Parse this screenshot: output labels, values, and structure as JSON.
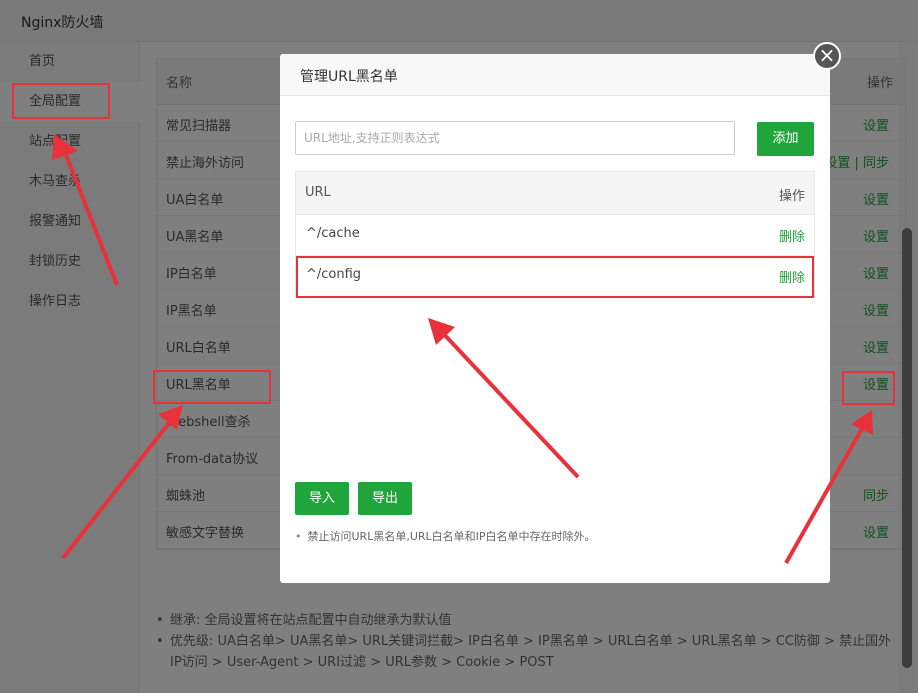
{
  "app_title": "Nginx防火墙",
  "sidebar": {
    "items": [
      {
        "label": "首页"
      },
      {
        "label": "全局配置"
      },
      {
        "label": "站点配置"
      },
      {
        "label": "木马查杀"
      },
      {
        "label": "报警通知"
      },
      {
        "label": "封锁历史"
      },
      {
        "label": "操作日志"
      }
    ]
  },
  "table": {
    "header_name": "名称",
    "header_op": "操作",
    "rows": [
      {
        "name": "常见扫描器",
        "op": "设置"
      },
      {
        "name": "禁止海外访问",
        "op": "设置 | 同步"
      },
      {
        "name": "UA白名单",
        "op": "设置"
      },
      {
        "name": "UA黑名单",
        "op": "设置"
      },
      {
        "name": "IP白名单",
        "op": "设置"
      },
      {
        "name": "IP黑名单",
        "op": "设置"
      },
      {
        "name": "URL白名单",
        "op": "设置"
      },
      {
        "name": "URL黑名单",
        "op": "设置"
      },
      {
        "name": "Webshell查杀",
        "op": ""
      },
      {
        "name": "From-data协议",
        "op": ""
      },
      {
        "name": "蜘蛛池",
        "op": "同步"
      },
      {
        "name": "敏感文字替换",
        "op": "设置"
      }
    ]
  },
  "notes": [
    "继承: 全局设置将在站点配置中自动继承为默认值",
    "优先级: UA白名单> UA黑名单> URL关键词拦截> IP白名单 > IP黑名单 > URL白名单 > URL黑名单 > CC防御 > 禁止国外IP访问 > User-Agent > URI过滤 > URL参数 > Cookie > POST"
  ],
  "modal": {
    "title": "管理URL黑名单",
    "close_symbol": "×",
    "input_placeholder": "URL地址,支持正则表达式",
    "add_label": "添加",
    "col_url": "URL",
    "col_op": "操作",
    "rows": [
      {
        "url": "^/cache",
        "op": "删除"
      },
      {
        "url": "^/config",
        "op": "删除"
      }
    ],
    "import_label": "导入",
    "export_label": "导出",
    "note": "禁止访问URL黑名单,URL白名单和IP白名单中存在时除外。"
  },
  "colors": {
    "accent": "#20a53a",
    "highlight": "#e8313a"
  }
}
